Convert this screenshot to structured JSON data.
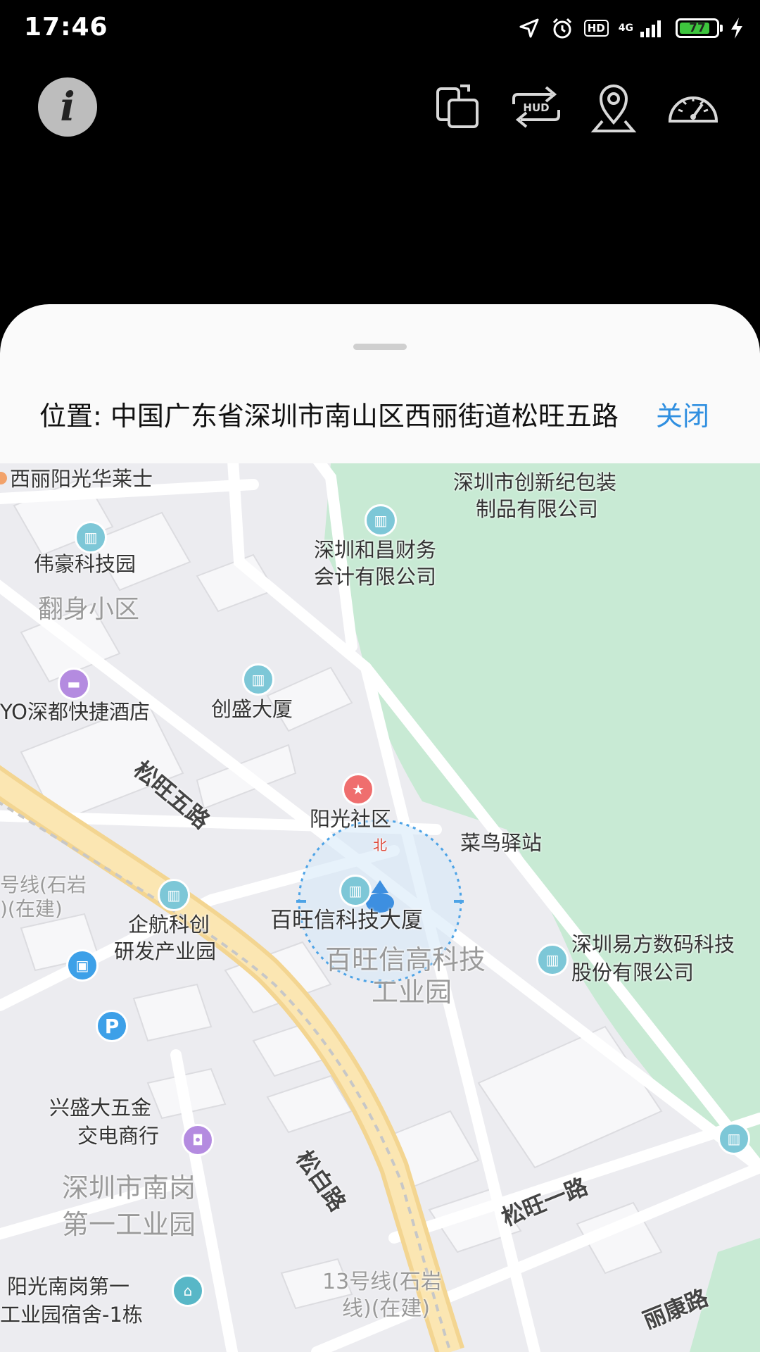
{
  "status_bar": {
    "time": "17:46",
    "hd_label": "HD",
    "network": "4G",
    "battery": "77"
  },
  "toolbar": {
    "info_button": "i",
    "hud_label": "HUD"
  },
  "panel": {
    "location_text": "位置: 中国广东省深圳市南山区西丽街道松旺五路",
    "close_label": "关闭"
  },
  "map": {
    "north_label": "北",
    "labels": {
      "xili_yangguang": "西丽阳光华莱士",
      "weihao": "伟豪科技园",
      "fanshen": "翻身小区",
      "shenduo_hotel": "YO深都快捷酒店",
      "chuangsheng": "创盛大厦",
      "hechang_1": "深圳和昌财务",
      "hechang_2": "会计有限公司",
      "chuangxinji_1": "深圳市创新纪包装",
      "chuangxinji_2": "制品有限公司",
      "songwang_5": "松旺五路",
      "yangguang_shequ": "阳光社区",
      "cainiao": "菜鸟驿站",
      "line13_left_1": "号线(石岩",
      "line13_left_2": ")(在建)",
      "qihang_1": "企航科创",
      "qihang_2": "研发产业园",
      "baiwangxin_bld": "百旺信科技大厦",
      "baiwangxin_park_1": "百旺信高科技",
      "baiwangxin_park_2": "工业园",
      "yifang_1": "深圳易方数码科技",
      "yifang_2": "股份有限公司",
      "xingsheng_1": "兴盛大五金",
      "xingsheng_2": "交电商行",
      "nangang_1": "深圳市南岗",
      "nangang_2": "第一工业园",
      "songbai": "松白路",
      "songwang_1": "松旺一路",
      "yangguang_nangang_1": "阳光南岗第一",
      "yangguang_nangang_2": "工业园宿舍-1栋",
      "line13_bottom_1": "13号线(石岩",
      "line13_bottom_2": "线)(在建)",
      "likang": "丽康路",
      "parking": "P"
    }
  }
}
